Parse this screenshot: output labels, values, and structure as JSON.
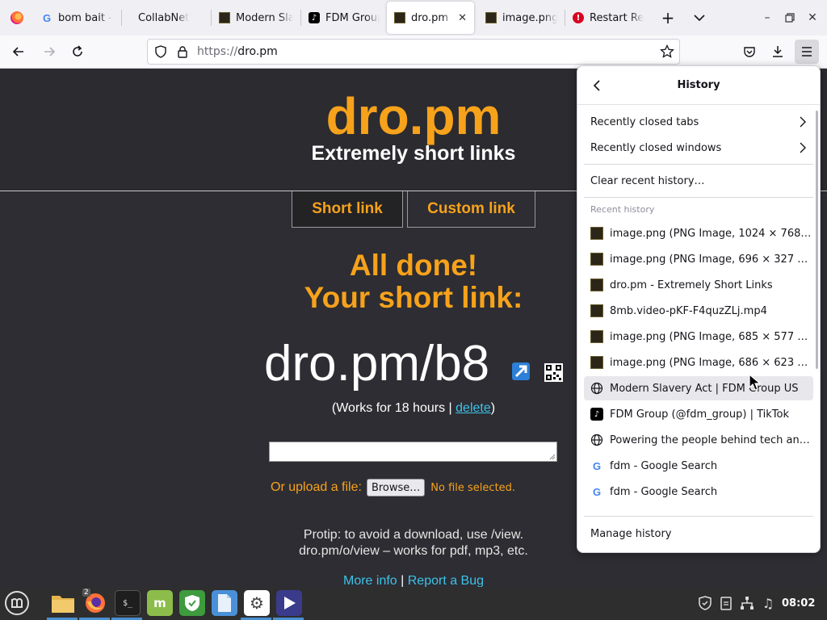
{
  "tabs": [
    {
      "title": "bom bait -",
      "favicon": "google-icon",
      "active": false
    },
    {
      "title": "CollabNet",
      "favicon": "none",
      "active": false
    },
    {
      "title": "Modern Sla",
      "favicon": "image-thumb-icon",
      "active": false
    },
    {
      "title": "FDM Group",
      "favicon": "tiktok-icon",
      "active": false
    },
    {
      "title": "dro.pm -",
      "favicon": "image-thumb-icon",
      "active": true
    },
    {
      "title": "image.png",
      "favicon": "image-thumb-icon",
      "active": false
    },
    {
      "title": "Restart Re",
      "favicon": "error-icon",
      "active": false
    }
  ],
  "urlbar": {
    "scheme": "https://",
    "host": "dro.pm"
  },
  "page": {
    "site_title": "dro.pm",
    "site_subtitle": "Extremely short links",
    "tab_short": "Short link",
    "tab_custom": "Custom link",
    "done_line1": "All done!",
    "done_line2": "Your short link:",
    "short_link": "dro.pm/b8",
    "works_prefix": "(Works for 18 hours | ",
    "delete_label": "delete",
    "works_suffix": ")",
    "upload_label": "Or upload a file:",
    "browse_label": "Browse…",
    "no_file": "No file selected.",
    "protip_line1": "Protip: to avoid a download, use /view.",
    "protip_line2": "dro.pm/o/view – works for pdf, mp3, etc.",
    "more_info": "More info",
    "footer_sep": " | ",
    "report_bug": "Report a Bug"
  },
  "history_panel": {
    "title": "History",
    "recently_closed_tabs": "Recently closed tabs",
    "recently_closed_windows": "Recently closed windows",
    "clear_recent": "Clear recent history…",
    "recent_label": "Recent history",
    "items": [
      {
        "title": "image.png (PNG Image, 1024 × 768 pi…",
        "icon": "image-thumb-icon"
      },
      {
        "title": "image.png (PNG Image, 696 × 327 pix…",
        "icon": "image-thumb-icon"
      },
      {
        "title": "dro.pm - Extremely Short Links",
        "icon": "image-thumb-icon"
      },
      {
        "title": "8mb.video-pKF-F4quzZLj.mp4",
        "icon": "image-thumb-icon"
      },
      {
        "title": "image.png (PNG Image, 685 × 577 pix…",
        "icon": "image-thumb-icon"
      },
      {
        "title": "image.png (PNG Image, 686 × 623 pix…",
        "icon": "image-thumb-icon"
      },
      {
        "title": "Modern Slavery Act | FDM Group US",
        "icon": "globe-icon"
      },
      {
        "title": "FDM Group (@fdm_group) | TikTok",
        "icon": "tiktok-icon"
      },
      {
        "title": "Powering the people behind tech and …",
        "icon": "globe-icon"
      },
      {
        "title": "fdm - Google Search",
        "icon": "google-icon"
      },
      {
        "title": "fdm - Google Search",
        "icon": "google-icon"
      }
    ],
    "manage": "Manage history"
  },
  "taskbar": {
    "firefox_badge": "2",
    "clock": "08:02"
  },
  "colors": {
    "accent_orange": "#f7a21b",
    "link_blue": "#3cc3e8",
    "page_bg": "#2d2d33"
  }
}
